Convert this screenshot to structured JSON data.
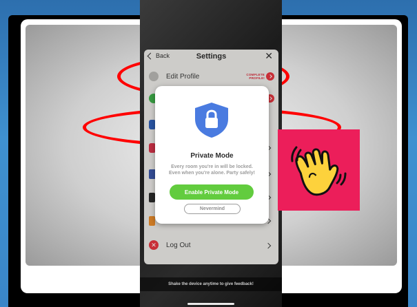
{
  "settings": {
    "back_label": "Back",
    "title": "Settings",
    "close_label": "✕",
    "edit_profile_label": "Edit Profile",
    "complete_profile_line1": "COMPLETE",
    "complete_profile_line2": "PROFILE!",
    "logout_label": "Log Out"
  },
  "modal": {
    "title": "Private Mode",
    "body_line1": "Every room you're in will be locked.",
    "body_line2": "Even when you're alone. Party safely!",
    "primary_button": "Enable Private Mode",
    "secondary_button": "Nevermind"
  },
  "feedback_text": "Shake the device anytime to give feedback!",
  "colors": {
    "annotation_red": "#ff0000",
    "brand_pink": "#ec1e5a",
    "primary_green": "#62cc3e",
    "shield_blue": "#4a7be0",
    "destructive_red": "#e3353f"
  },
  "icons": {
    "shield": "shield-lock-icon",
    "wave": "waving-hand-icon",
    "logout": "logout-icon"
  }
}
